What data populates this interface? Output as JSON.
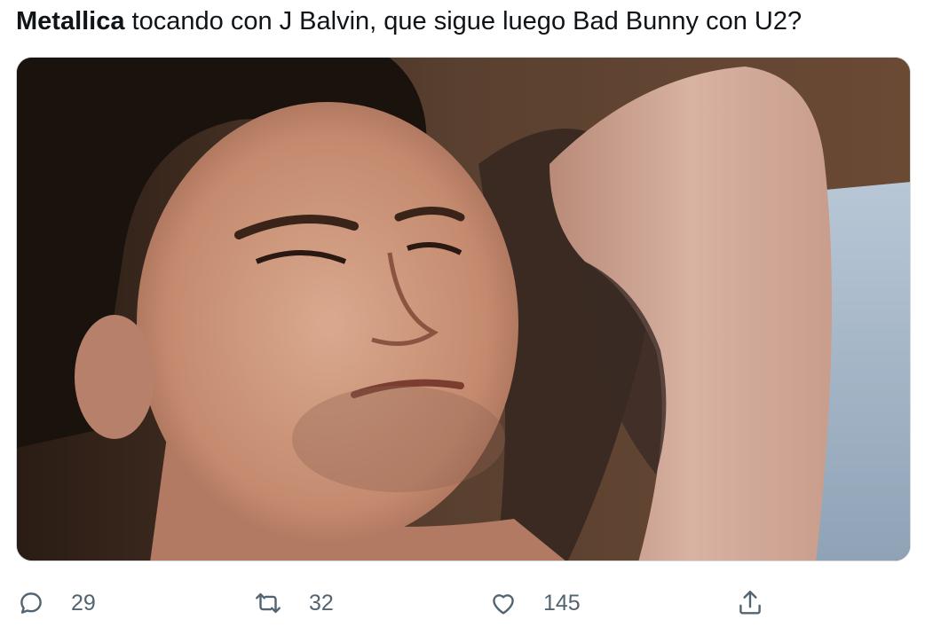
{
  "tweet": {
    "text_bold": "Metallica",
    "text_rest": " tocando con J Balvin, que sigue luego Bad Bunny con U2?"
  },
  "media": {
    "alt_description": "meme-photo-man-lying-arm-behind-head"
  },
  "actions": {
    "reply": {
      "icon": "speech-bubble-icon",
      "count": "29"
    },
    "retweet": {
      "icon": "retweet-arrows-icon",
      "count": "32"
    },
    "like": {
      "icon": "heart-icon",
      "count": "145"
    },
    "share": {
      "icon": "share-upload-icon"
    }
  },
  "colors": {
    "text": "#0f1419",
    "secondary": "#536471",
    "border": "#cfd9de"
  }
}
